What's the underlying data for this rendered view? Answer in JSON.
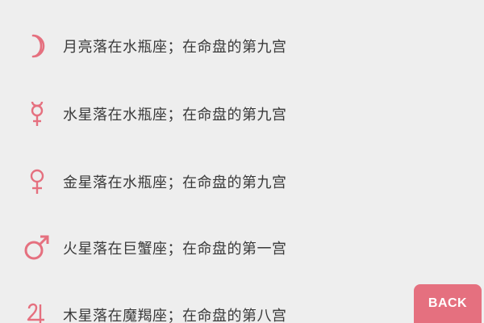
{
  "accent_color": "#e5707f",
  "planets": [
    {
      "icon": "moon-icon",
      "text": "月亮落在水瓶座；在命盘的第九宫"
    },
    {
      "icon": "mercury-icon",
      "text": "水星落在水瓶座；在命盘的第九宫"
    },
    {
      "icon": "venus-icon",
      "text": "金星落在水瓶座；在命盘的第九宫"
    },
    {
      "icon": "mars-icon",
      "text": "火星落在巨蟹座；在命盘的第一宫"
    },
    {
      "icon": "jupiter-icon",
      "text": "木星落在魔羯座；在命盘的第八宫"
    }
  ],
  "back_button": {
    "label": "BACK"
  }
}
